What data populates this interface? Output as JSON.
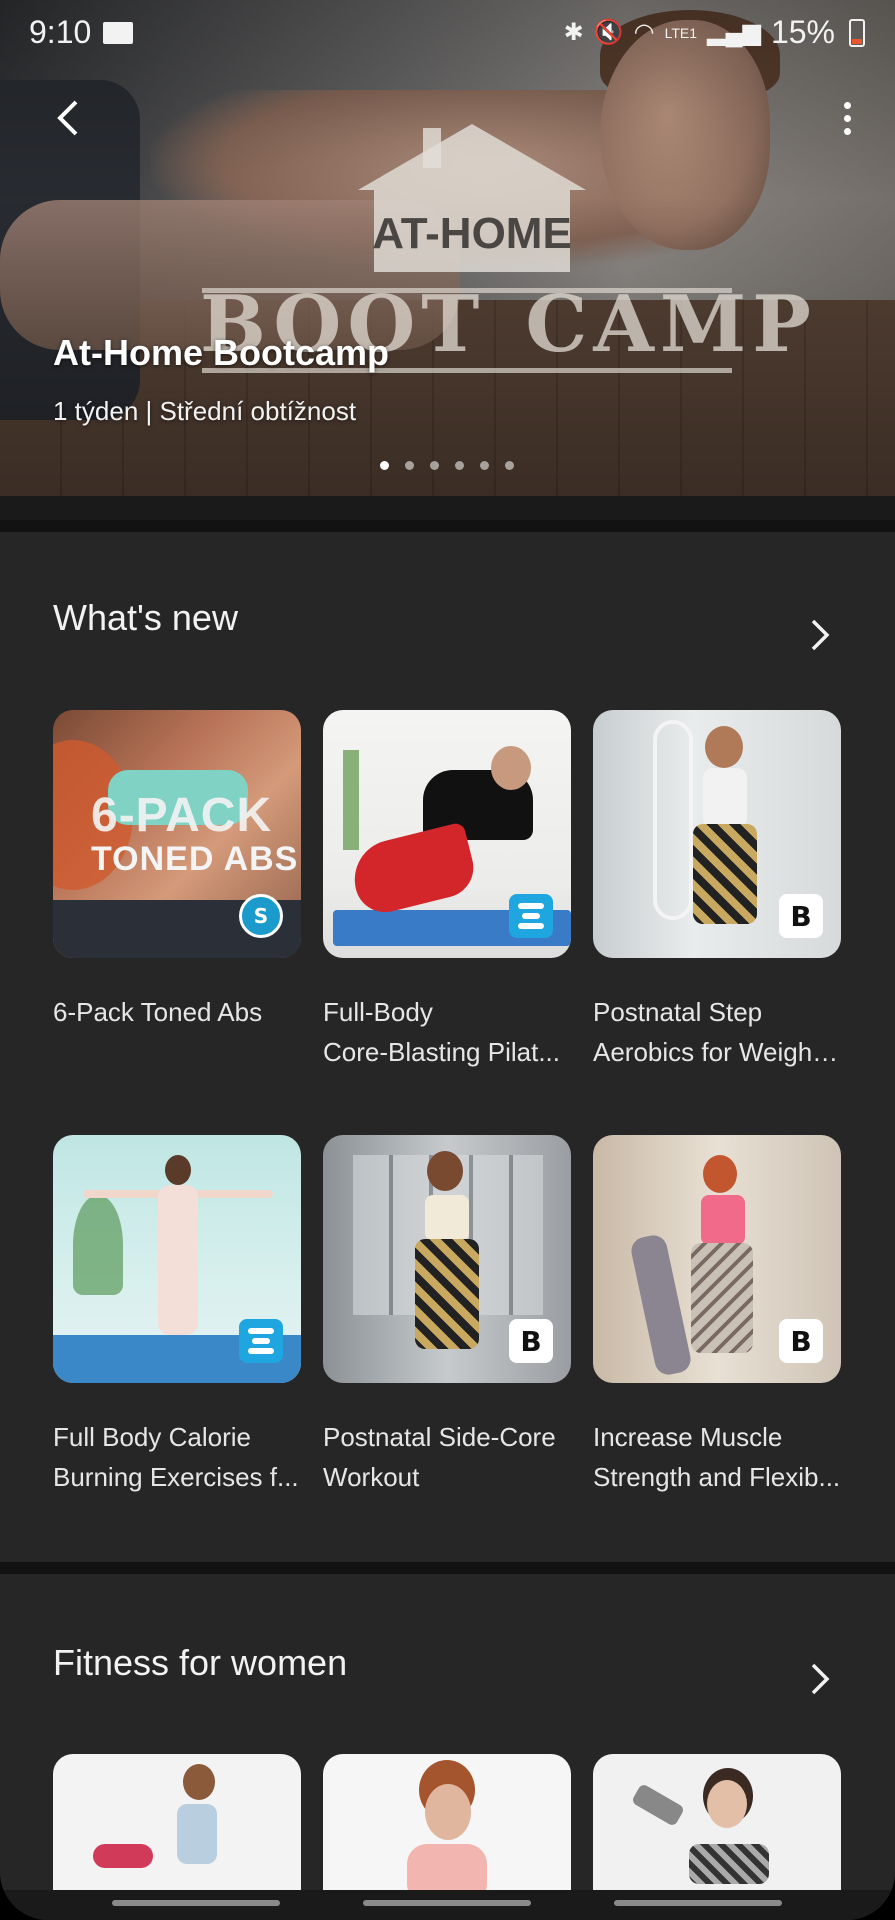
{
  "status_bar": {
    "time": "9:10",
    "battery": "15%",
    "network": "LTE1"
  },
  "hero": {
    "title": "At-Home Bootcamp",
    "subtitle": "1 týden | Střední obtížnost",
    "logo_top": "AT-HOME",
    "logo_word1": "BOOT",
    "logo_word2": "CAMP",
    "page_count": 6,
    "active_page": 1
  },
  "whats_new": {
    "title": "What's new",
    "items": [
      {
        "line1": "6-Pack Toned Abs",
        "line2": "",
        "thumb_text1": "6-PACK",
        "thumb_text2": "TONED ABS",
        "badge": "samsung-health-icon"
      },
      {
        "line1": "Full-Body",
        "line2": "Core-Blasting Pilat...",
        "badge": "blue-lines-icon"
      },
      {
        "line1": "Postnatal Step",
        "line2": "Aerobics for Weight...",
        "badge": "b-logo-icon"
      },
      {
        "line1": "Full Body Calorie",
        "line2": "Burning Exercises f...",
        "badge": "blue-lines-icon"
      },
      {
        "line1": "Postnatal Side-Core",
        "line2": "Workout",
        "badge": "b-logo-icon"
      },
      {
        "line1": "Increase Muscle",
        "line2": "Strength and Flexib...",
        "badge": "b-logo-icon"
      }
    ],
    "badge_letter": "B"
  },
  "fitness_women": {
    "title": "Fitness for women"
  },
  "colors": {
    "background": "#1a1a1a",
    "section": "#262626",
    "text": "#f2f2f2",
    "badge_blue": "#1fa5e0"
  }
}
